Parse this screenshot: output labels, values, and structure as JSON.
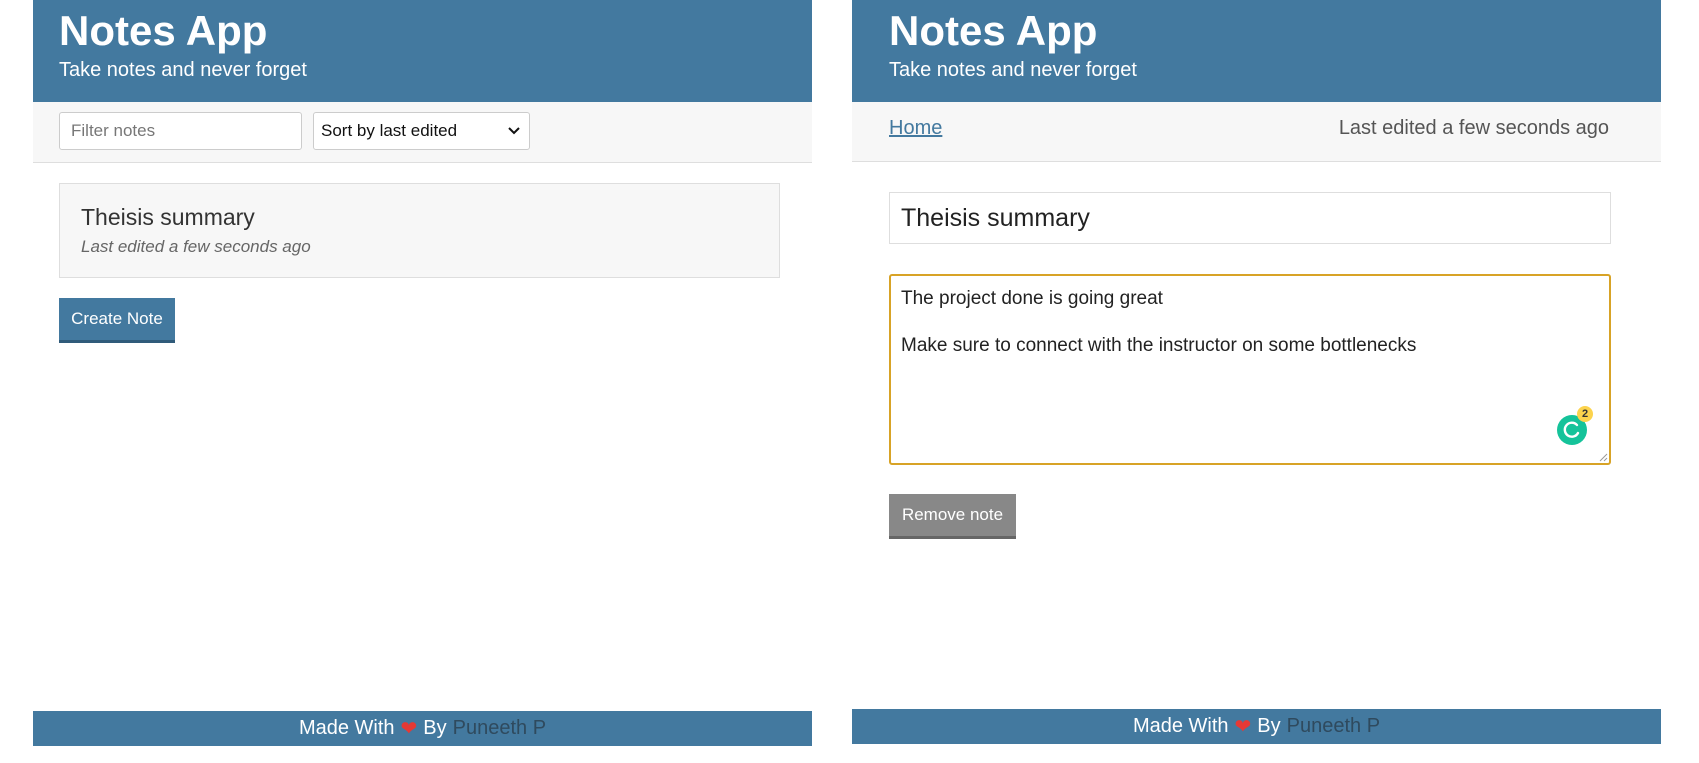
{
  "app": {
    "title": "Notes App",
    "subtitle": "Take notes and never forget"
  },
  "list_view": {
    "filter": {
      "placeholder": "Filter notes",
      "value": ""
    },
    "sort": {
      "selected": "Sort by last edited"
    },
    "notes": [
      {
        "title": "Theisis summary",
        "subtitle": "Last edited a few seconds ago"
      }
    ],
    "create_button": "Create Note"
  },
  "edit_view": {
    "home_link": "Home",
    "last_edited": "Last edited a few seconds ago",
    "title_value": "Theisis summary",
    "body_lines": [
      "The project done is going great",
      "Make sure to connect with the instructor on some bottlenecks"
    ],
    "assistant_badge": "2",
    "remove_button": "Remove note"
  },
  "footer": {
    "made_with": "Made With",
    "heart": "❤",
    "by": "By",
    "author": "Puneeth P"
  },
  "icons": {
    "sort": "chevron-down-icon",
    "writing_assistant": "writing-assistant-icon",
    "footer": "heart-icon"
  },
  "colors": {
    "brand": "#43799f",
    "textarea_focus": "#d8a326",
    "remove_button": "#888888",
    "heart": "#e53935",
    "assistant": "#15c39a"
  }
}
